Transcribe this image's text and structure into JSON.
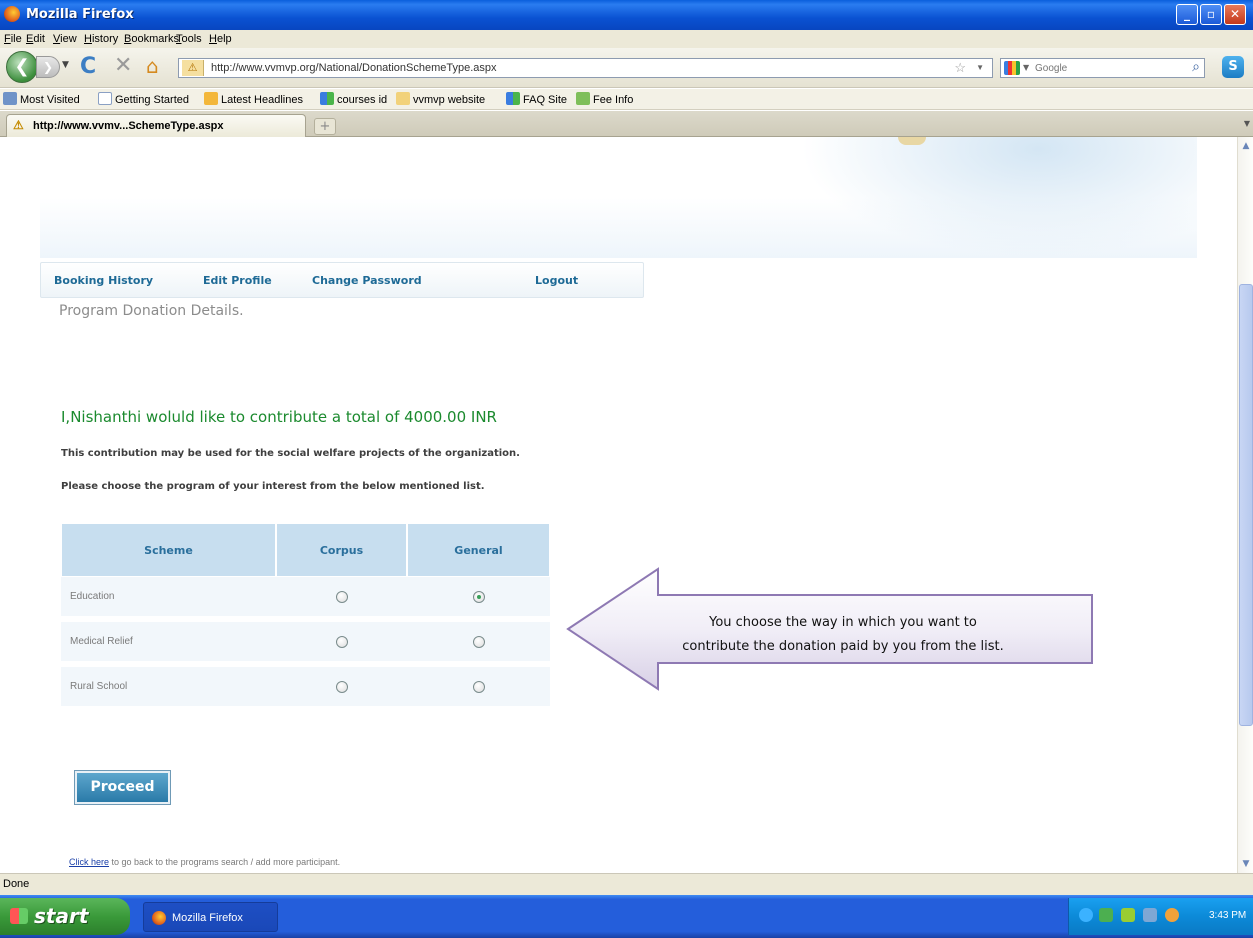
{
  "window": {
    "title": "Mozilla Firefox"
  },
  "menu": [
    "File",
    "Edit",
    "View",
    "History",
    "Bookmarks",
    "Tools",
    "Help"
  ],
  "nav": {
    "url": "http://www.vvmvp.org/National/DonationSchemeType.aspx",
    "search_placeholder": "Google"
  },
  "bookmarks": [
    "Most Visited",
    "Getting Started",
    "Latest Headlines",
    "courses id",
    "vvmvp website",
    "FAQ Site",
    "Fee Info"
  ],
  "tab": {
    "label": "http://www.vvmv...SchemeType.aspx"
  },
  "userbar": {
    "booking_history": "Booking History",
    "edit_profile": "Edit Profile",
    "change_password": "Change Password",
    "logout": "Logout"
  },
  "page": {
    "section_title": "Program Donation Details.",
    "heading": "I,Nishanthi woluld like to contribute a total of 4000.00 INR",
    "line1": "This contribution may be used for the social welfare projects of the organization.",
    "line2": "Please choose the program of your interest from the below mentioned list.",
    "table": {
      "headers": [
        "Scheme",
        "Corpus",
        "General"
      ],
      "rows": [
        {
          "scheme": "Education",
          "corpus": false,
          "general": true
        },
        {
          "scheme": "Medical Relief",
          "corpus": false,
          "general": false
        },
        {
          "scheme": "Rural School",
          "corpus": false,
          "general": false
        }
      ]
    },
    "proceed_label": "Proceed",
    "back_link": "Click here",
    "back_text": " to go back to the programs search / add more participant."
  },
  "callout": {
    "line1": "You choose the way in which you want to",
    "line2": "contribute the donation paid by you from the list."
  },
  "status": "Done",
  "taskbar": {
    "start": "start",
    "item": "Mozilla Firefox",
    "clock": "3:43 PM"
  }
}
